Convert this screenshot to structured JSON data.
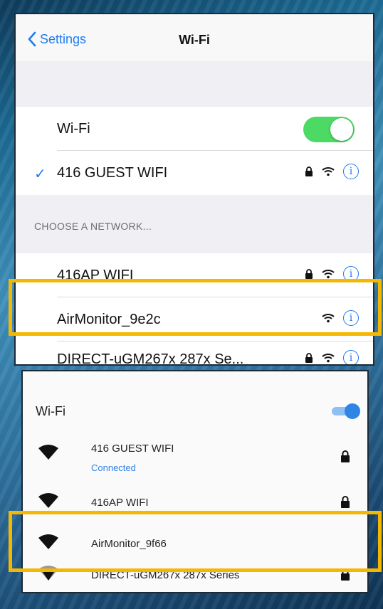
{
  "ios": {
    "back_label": "Settings",
    "title": "Wi-Fi",
    "wifi_label": "Wi-Fi",
    "wifi_on": true,
    "connected_network": "416 GUEST WIFI",
    "section_header": "CHOOSE A NETWORK...",
    "networks": [
      {
        "name": "416AP WIFI",
        "locked": true
      },
      {
        "name": "AirMonitor_9e2c",
        "locked": false
      },
      {
        "name": "DIRECT-uGM267x 287x Se...",
        "locked": true
      }
    ]
  },
  "android": {
    "title": "Wi-Fi",
    "wifi_on": true,
    "networks": [
      {
        "name": "416 GUEST WIFI",
        "status": "Connected",
        "locked": true
      },
      {
        "name": "416AP WIFI",
        "status": "",
        "locked": true
      },
      {
        "name": "AirMonitor_9f66",
        "status": "",
        "locked": false
      },
      {
        "name": "DIRECT-uGM267x 287x Series",
        "status": "",
        "locked": true
      }
    ]
  },
  "colors": {
    "accent": "#1e7cf2",
    "toggle_on": "#4cd964",
    "highlight": "#f5b800",
    "android_accent": "#2f84e6"
  }
}
